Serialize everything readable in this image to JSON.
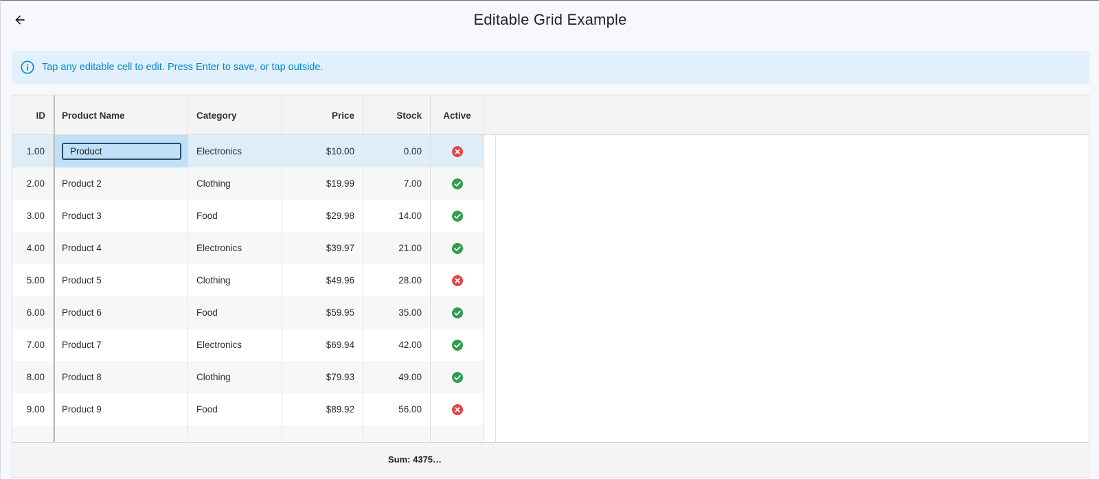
{
  "header": {
    "title": "Editable Grid Example",
    "back_icon": "arrow-left-icon"
  },
  "banner": {
    "icon": "info-icon",
    "text": "Tap any editable cell to edit. Press Enter to save, or tap outside."
  },
  "grid": {
    "columns": [
      {
        "label": "ID",
        "align": "right"
      },
      {
        "label": "Product Name",
        "align": "left"
      },
      {
        "label": "Category",
        "align": "left"
      },
      {
        "label": "Price",
        "align": "right"
      },
      {
        "label": "Stock",
        "align": "right"
      },
      {
        "label": "Active",
        "align": "center"
      }
    ],
    "editing_value": "Product",
    "rows": [
      {
        "id": "1.00",
        "name": "Product",
        "category": "Electronics",
        "price": "$10.00",
        "stock": "0.00",
        "active": false
      },
      {
        "id": "2.00",
        "name": "Product 2",
        "category": "Clothing",
        "price": "$19.99",
        "stock": "7.00",
        "active": true
      },
      {
        "id": "3.00",
        "name": "Product 3",
        "category": "Food",
        "price": "$29.98",
        "stock": "14.00",
        "active": true
      },
      {
        "id": "4.00",
        "name": "Product 4",
        "category": "Electronics",
        "price": "$39.97",
        "stock": "21.00",
        "active": true
      },
      {
        "id": "5.00",
        "name": "Product 5",
        "category": "Clothing",
        "price": "$49.96",
        "stock": "28.00",
        "active": false
      },
      {
        "id": "6.00",
        "name": "Product 6",
        "category": "Food",
        "price": "$59.95",
        "stock": "35.00",
        "active": true
      },
      {
        "id": "7.00",
        "name": "Product 7",
        "category": "Electronics",
        "price": "$69.94",
        "stock": "42.00",
        "active": true
      },
      {
        "id": "8.00",
        "name": "Product 8",
        "category": "Clothing",
        "price": "$79.93",
        "stock": "49.00",
        "active": true
      },
      {
        "id": "9.00",
        "name": "Product 9",
        "category": "Food",
        "price": "$89.92",
        "stock": "56.00",
        "active": false
      }
    ],
    "footer_sum": "Sum: 4375…"
  },
  "colors": {
    "active_true": "#2e9e4f",
    "active_false": "#e8434a",
    "banner_text": "#0288d1",
    "banner_bg": "#e1f0fa"
  }
}
